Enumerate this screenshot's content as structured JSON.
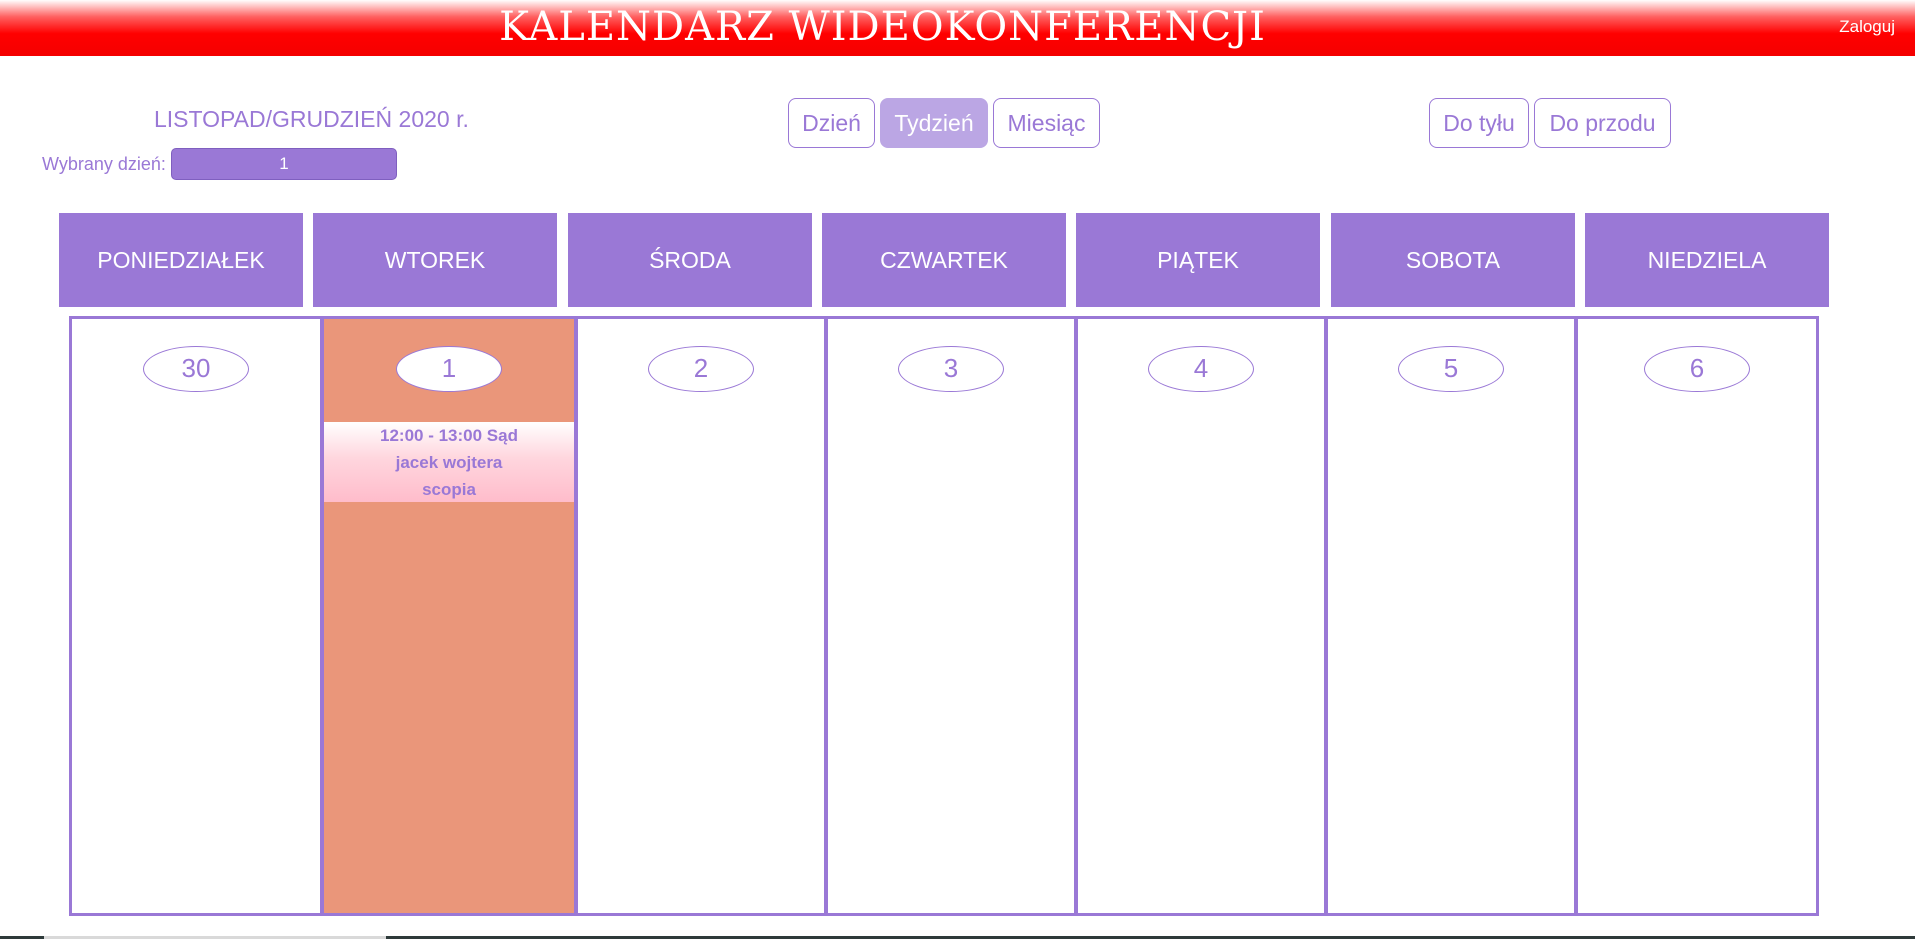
{
  "header": {
    "title": "KALENDARZ WIDEOKONFERENCJI",
    "login": "Zaloguj"
  },
  "period": {
    "title": "LISTOPAD/GRUDZIEŃ 2020 r.",
    "selected_label": "Wybrany dzień:",
    "selected_value": "1"
  },
  "views": {
    "day": "Dzień",
    "week": "Tydzień",
    "month": "Miesiąc",
    "active": "week"
  },
  "navigation": {
    "back": "Do tyłu",
    "forward": "Do przodu"
  },
  "weekdays": [
    "PONIEDZIAŁEK",
    "WTOREK",
    "ŚRODA",
    "CZWARTEK",
    "PIĄTEK",
    "SOBOTA",
    "NIEDZIELA"
  ],
  "days": [
    {
      "number": "30",
      "selected": false,
      "events": []
    },
    {
      "number": "1",
      "selected": true,
      "events": [
        {
          "line1": "12:00 - 13:00 Sąd",
          "line2": "jacek wojtera",
          "line3": "scopia"
        }
      ]
    },
    {
      "number": "2",
      "selected": false,
      "events": []
    },
    {
      "number": "3",
      "selected": false,
      "events": []
    },
    {
      "number": "4",
      "selected": false,
      "events": []
    },
    {
      "number": "5",
      "selected": false,
      "events": []
    },
    {
      "number": "6",
      "selected": false,
      "events": []
    }
  ],
  "colors": {
    "accent": "#9a78d6",
    "active_button": "#bba6e4",
    "header_red": "#ff0000",
    "selected_day": "#ea967a",
    "event_pink": "#ffbccb"
  }
}
